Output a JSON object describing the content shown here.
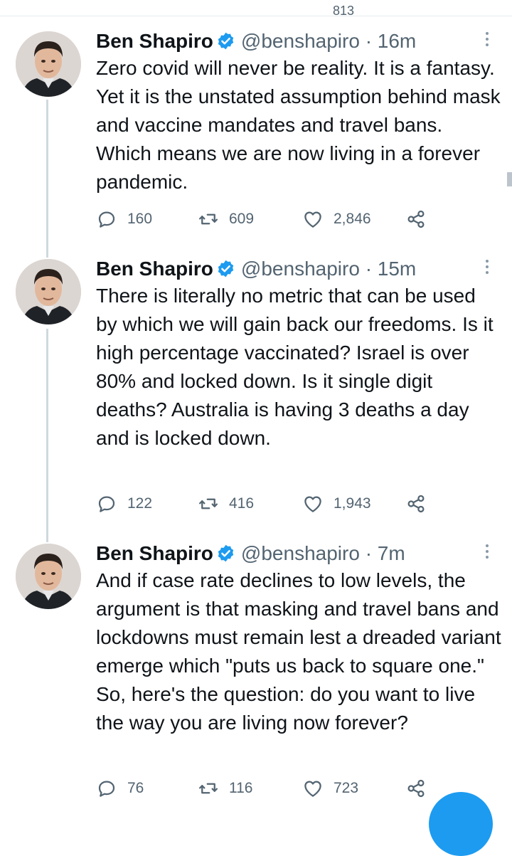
{
  "top": {
    "count": "813"
  },
  "author": {
    "name": "Ben Shapiro",
    "handle": "@benshapiro"
  },
  "tweets": [
    {
      "time": "· 16m",
      "text": "Zero covid will never be reality. It is a fantasy. Yet it is the unstated assumption behind mask and vaccine mandates and travel bans. Which means we are now living in a forever pandemic.",
      "replies": "160",
      "retweets": "609",
      "likes": "2,846"
    },
    {
      "time": "· 15m",
      "text": "There is literally no metric that can be used by which we will gain back our freedoms. Is it high percentage vaccinated? Israel is over 80% and locked down. Is it single digit deaths? Australia is having 3 deaths a day and is locked down.",
      "replies": "122",
      "retweets": "416",
      "likes": "1,943"
    },
    {
      "time": "· 7m",
      "text": "And if case rate declines to low levels, the argument is that masking and travel bans and lockdowns must remain lest a dreaded variant emerge which \"puts us back to square one.\" So, here's the question: do you want to live the way you are living now forever?",
      "replies": "76",
      "retweets": "116",
      "likes": "723"
    }
  ],
  "icons": {
    "reply": "reply-icon",
    "retweet": "retweet-icon",
    "like": "heart-icon",
    "share": "share-icon",
    "verified": "verified-badge-icon",
    "more": "more-vertical-icon"
  },
  "colors": {
    "accent": "#1d9bf0",
    "secondary_text": "#536471",
    "thread_line": "#cfd9de"
  }
}
